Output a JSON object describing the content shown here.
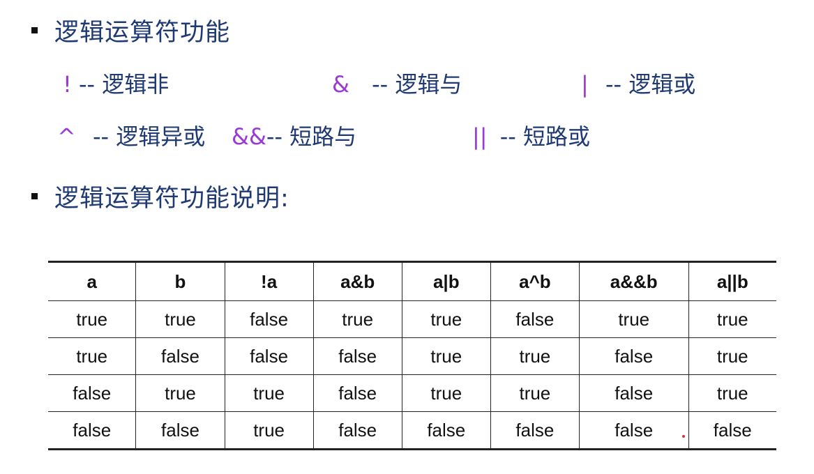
{
  "section1": {
    "title": "逻辑运算符功能"
  },
  "operators": [
    {
      "symbol": "!",
      "dash": "--",
      "label": "逻辑非"
    },
    {
      "symbol": "&",
      "dash": "--",
      "label": "逻辑与"
    },
    {
      "symbol": "|",
      "dash": "--",
      "label": "逻辑或"
    },
    {
      "symbol": "^",
      "dash": "--",
      "label": "逻辑异或"
    },
    {
      "symbol": "&&",
      "dash": "--",
      "label": "短路与"
    },
    {
      "symbol": "||",
      "dash": "--",
      "label": "短路或"
    }
  ],
  "section2": {
    "title": "逻辑运算符功能说明:"
  },
  "truth_table": {
    "headers": [
      "a",
      "b",
      "!a",
      "a&b",
      "a|b",
      "a^b",
      "a&&b",
      "a||b"
    ],
    "rows": [
      [
        "true",
        "true",
        "false",
        "true",
        "true",
        "false",
        "true",
        "true"
      ],
      [
        "true",
        "false",
        "false",
        "false",
        "true",
        "true",
        "false",
        "true"
      ],
      [
        "false",
        "true",
        "true",
        "false",
        "true",
        "true",
        "false",
        "true"
      ],
      [
        "false",
        "false",
        "true",
        "false",
        "false",
        "false",
        "false",
        "false"
      ]
    ]
  },
  "colors": {
    "heading": "#1f3a73",
    "operator_symbol": "#9b39d6",
    "table_border": "#222222"
  }
}
